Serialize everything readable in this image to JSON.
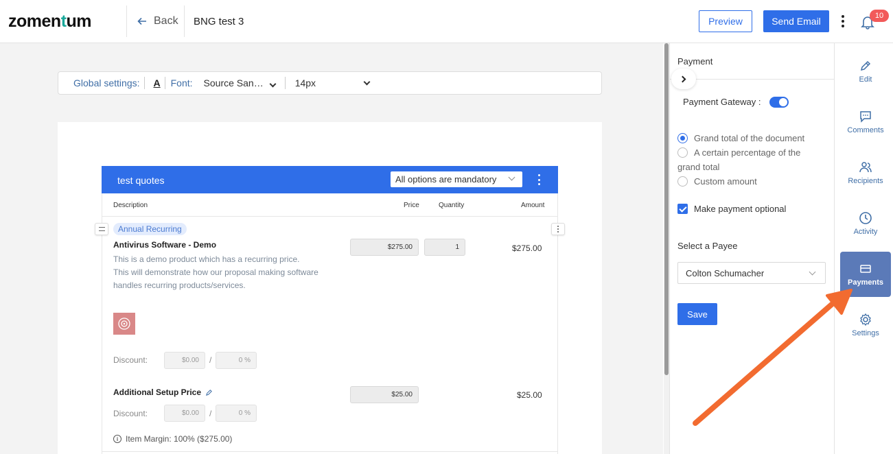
{
  "header": {
    "logo": "zomentum",
    "back_label": "Back",
    "doc_title": "BNG test 3",
    "preview_label": "Preview",
    "send_email_label": "Send Email",
    "notification_count": "10"
  },
  "global_settings": {
    "label": "Global settings:",
    "text_color_glyph": "A",
    "font_label": "Font:",
    "font_value": "Source San…",
    "size_value": "14px"
  },
  "quote": {
    "title": "test quotes",
    "mandatory_select": "All options are mandatory",
    "columns": {
      "description": "Description",
      "price": "Price",
      "quantity": "Quantity",
      "amount": "Amount"
    },
    "item1": {
      "tag": "Annual Recurring",
      "name": "Antivirus Software - Demo",
      "desc_line1": "This is a demo product which has a recurring price.",
      "desc_line2": "This will demonstrate how our proposal making software",
      "desc_line3": "handles recurring products/services.",
      "price": "$275.00",
      "quantity": "1",
      "amount": "$275.00",
      "discount_label": "Discount:",
      "discount_amount": "$0.00",
      "discount_sep": "/",
      "discount_percent": "0 %"
    },
    "item2": {
      "name": "Additional Setup Price",
      "price": "$25.00",
      "amount": "$25.00",
      "discount_label": "Discount:",
      "discount_amount": "$0.00",
      "discount_sep": "/",
      "discount_percent": "0 %"
    },
    "margin": {
      "info_glyph": "i",
      "text": "Item Margin: 100% ($275.00)"
    }
  },
  "payment": {
    "title": "Payment",
    "gateway_label": "Payment Gateway :",
    "gateway_enabled": true,
    "option_grand_total": "Grand total of the document",
    "option_percentage_line1": "A certain percentage of the",
    "option_percentage_line2": "grand total",
    "option_custom": "Custom amount",
    "make_optional_label": "Make payment optional",
    "payee_label": "Select a Payee",
    "payee_value": "Colton Schumacher",
    "save_label": "Save"
  },
  "rail": {
    "edit": "Edit",
    "comments": "Comments",
    "recipients": "Recipients",
    "activity": "Activity",
    "payments": "Payments",
    "settings": "Settings"
  },
  "colors": {
    "accent": "#2f6ee8",
    "rail_active": "#5b7ab8",
    "annotation_arrow": "#f26b30",
    "badge": "#f25a5a"
  }
}
